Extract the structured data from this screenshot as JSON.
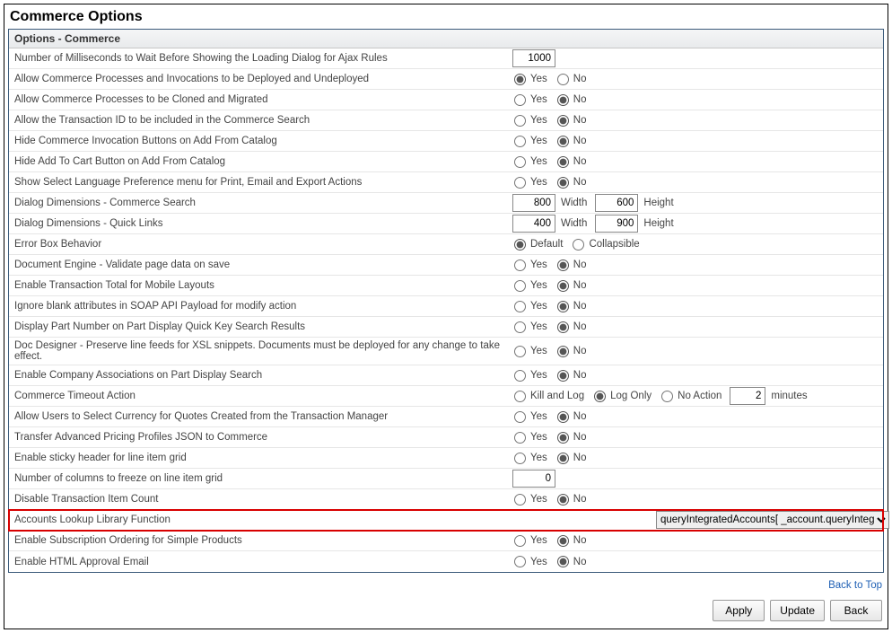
{
  "pageTitle": "Commerce Options",
  "panelHeader": "Options - Commerce",
  "radioLabels": {
    "yes": "Yes",
    "no": "No",
    "default": "Default",
    "collapsible": "Collapsible",
    "killLog": "Kill and Log",
    "logOnly": "Log Only",
    "noAction": "No Action"
  },
  "units": {
    "width": "Width",
    "height": "Height",
    "minutes": "minutes"
  },
  "rows": {
    "r0": {
      "label": "Number of Milliseconds to Wait Before Showing the Loading Dialog for Ajax Rules",
      "value": "1000"
    },
    "r1": {
      "label": "Allow Commerce Processes and Invocations to be Deployed and Undeployed",
      "sel": "yes"
    },
    "r2": {
      "label": "Allow Commerce Processes to be Cloned and Migrated",
      "sel": "no"
    },
    "r3": {
      "label": "Allow the Transaction ID to be included in the Commerce Search",
      "sel": "no"
    },
    "r4": {
      "label": "Hide Commerce Invocation Buttons on Add From Catalog",
      "sel": "no"
    },
    "r5": {
      "label": "Hide Add To Cart Button on Add From Catalog",
      "sel": "no"
    },
    "r6": {
      "label": "Show Select Language Preference menu for Print, Email and Export Actions",
      "sel": "no"
    },
    "r7": {
      "label": "Dialog Dimensions - Commerce Search",
      "w": "800",
      "h": "600"
    },
    "r8": {
      "label": "Dialog Dimensions - Quick Links",
      "w": "400",
      "h": "900"
    },
    "r9": {
      "label": "Error Box Behavior",
      "sel": "default"
    },
    "r10": {
      "label": "Document Engine - Validate page data on save",
      "sel": "no"
    },
    "r11": {
      "label": "Enable Transaction Total for Mobile Layouts",
      "sel": "no"
    },
    "r12": {
      "label": "Ignore blank attributes in SOAP API Payload for modify action",
      "sel": "no"
    },
    "r13": {
      "label": "Display Part Number on Part Display Quick Key Search Results",
      "sel": "no"
    },
    "r14": {
      "label": "Doc Designer - Preserve line feeds for XSL snippets. Documents must be deployed for any change to take effect.",
      "sel": "no"
    },
    "r15": {
      "label": "Enable Company Associations on Part Display Search",
      "sel": "no"
    },
    "r16": {
      "label": "Commerce Timeout Action",
      "sel": "logOnly",
      "value": "2"
    },
    "r17": {
      "label": "Allow Users to Select Currency for Quotes Created from the Transaction Manager",
      "sel": "no"
    },
    "r18": {
      "label": "Transfer Advanced Pricing Profiles JSON to Commerce",
      "sel": "no"
    },
    "r19": {
      "label": "Enable sticky header for line item grid",
      "sel": "no"
    },
    "r20": {
      "label": "Number of columns to freeze on line item grid",
      "value": "0"
    },
    "r21": {
      "label": "Disable Transaction Item Count",
      "sel": "no"
    },
    "r22": {
      "label": "Accounts Lookup Library Function",
      "value": "queryIntegratedAccounts[ _account.queryIntegratedAccounts]"
    },
    "r23": {
      "label": "Enable Subscription Ordering for Simple Products",
      "sel": "no"
    },
    "r24": {
      "label": "Enable HTML Approval Email",
      "sel": "no"
    }
  },
  "backToTop": "Back to Top",
  "buttons": {
    "apply": "Apply",
    "update": "Update",
    "back": "Back"
  }
}
